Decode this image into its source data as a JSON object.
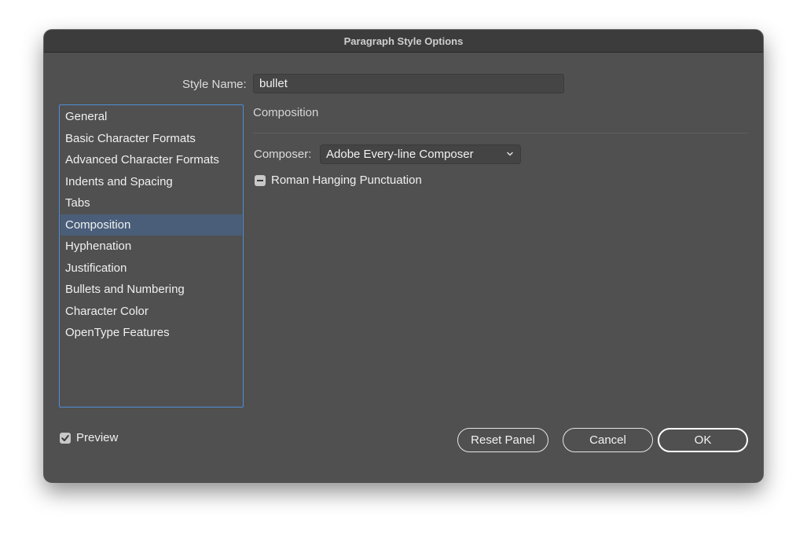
{
  "window": {
    "title": "Paragraph Style Options"
  },
  "style_name": {
    "label": "Style Name:",
    "value": "bullet"
  },
  "sidebar": {
    "items": [
      {
        "label": "General"
      },
      {
        "label": "Basic Character Formats"
      },
      {
        "label": "Advanced Character Formats"
      },
      {
        "label": "Indents and Spacing"
      },
      {
        "label": "Tabs"
      },
      {
        "label": "Composition",
        "selected": true
      },
      {
        "label": "Hyphenation"
      },
      {
        "label": "Justification"
      },
      {
        "label": "Bullets and Numbering"
      },
      {
        "label": "Character Color"
      },
      {
        "label": "OpenType Features"
      }
    ]
  },
  "panel": {
    "title": "Composition",
    "composer": {
      "label": "Composer:",
      "value": "Adobe Every-line Composer",
      "icon": "chevron-down-icon"
    },
    "roman_hanging_punctuation": {
      "label": "Roman Hanging Punctuation",
      "state": "indeterminate"
    }
  },
  "footer": {
    "preview": {
      "label": "Preview",
      "checked": true
    },
    "reset_label": "Reset Panel",
    "cancel_label": "Cancel",
    "ok_label": "OK"
  },
  "colors": {
    "dialog_bg": "#505050",
    "accent_border": "#4f8fd8",
    "selected_row": "#4a5e7a"
  }
}
